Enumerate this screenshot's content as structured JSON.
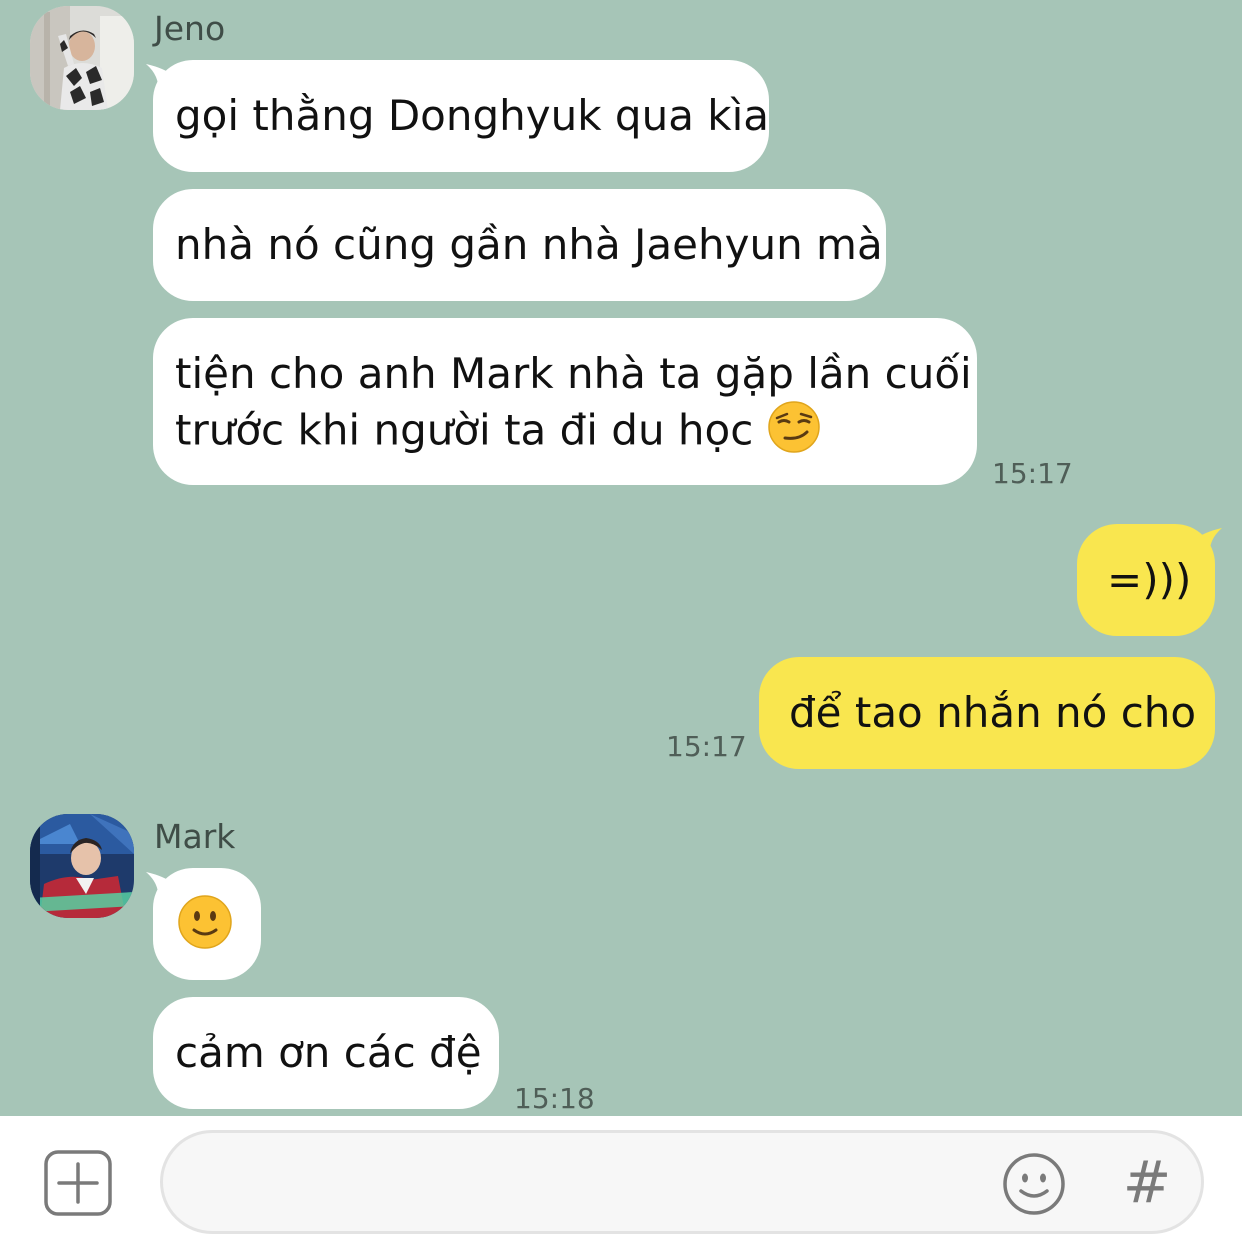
{
  "messages": {
    "jeno": {
      "name": "Jeno",
      "bubbles": [
        "gọi thằng Donghyuk qua kìa",
        "nhà nó cũng gần nhà Jaehyun mà",
        "tiện cho anh Mark nhà ta gặp lần cuối",
        "trước khi người ta đi du học"
      ],
      "time": "15:17"
    },
    "me": {
      "bubbles": [
        "=)))",
        "để tao nhắn nó cho"
      ],
      "time": "15:17"
    },
    "mark": {
      "name": "Mark",
      "bubbles": [
        "cảm ơn các đệ"
      ],
      "time": "15:18"
    }
  },
  "icons": {
    "smirk": "smirk-emoji",
    "smile": "slight-smile-emoji",
    "add": "plus-square-icon",
    "emoji_picker": "smiley-icon",
    "hashtag": "#"
  },
  "input": {
    "placeholder": ""
  },
  "colors": {
    "background": "#a6c5b7",
    "incoming_bubble": "#ffffff",
    "outgoing_bubble": "#f9e64f"
  }
}
